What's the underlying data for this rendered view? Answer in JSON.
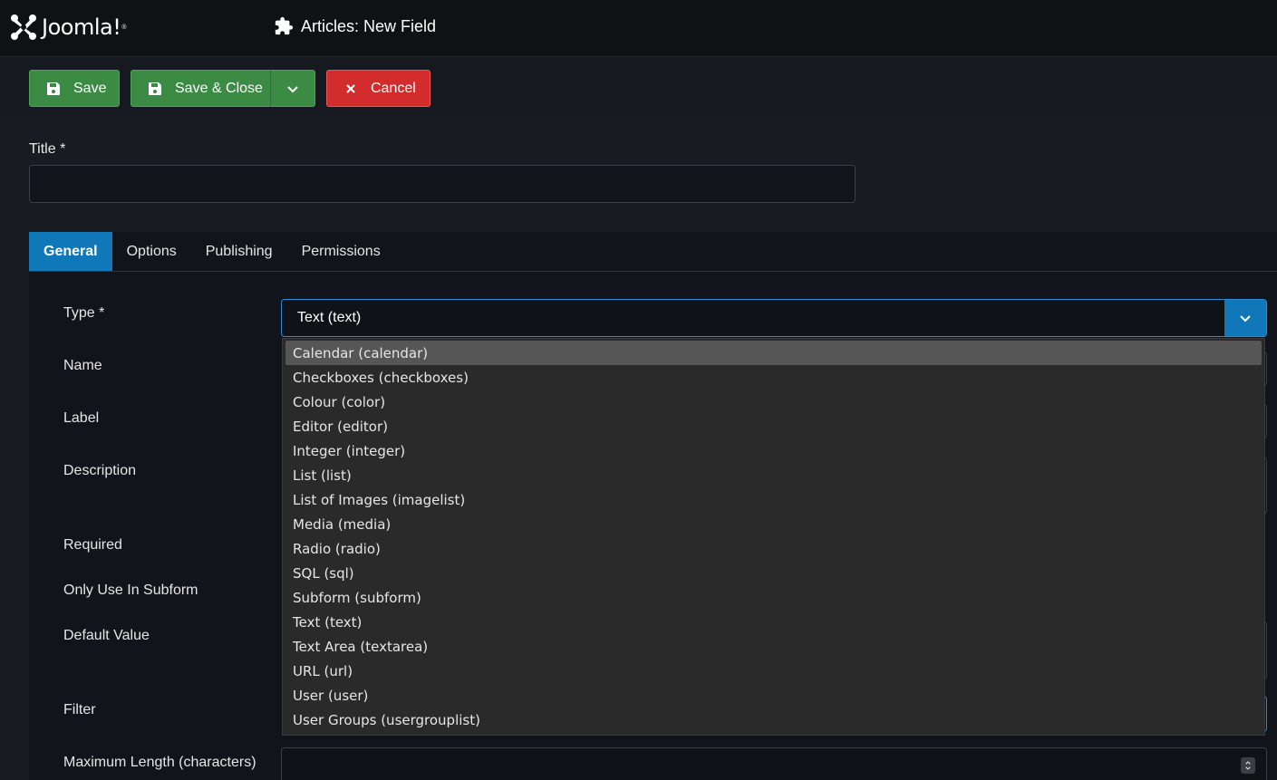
{
  "header": {
    "logo_text": "Joomla!",
    "logo_icon": "joomla-logo-icon",
    "page_title": "Articles: New Field",
    "page_icon": "puzzle-piece-icon"
  },
  "toolbar": {
    "save_label": "Save",
    "save_close_label": "Save & Close",
    "cancel_label": "Cancel",
    "save_icon": "floppy-disk-icon",
    "dropdown_icon": "chevron-down-icon",
    "cancel_icon": "close-icon"
  },
  "form": {
    "title_label": "Title *",
    "title_value": ""
  },
  "tabs": [
    {
      "label": "General",
      "active": true
    },
    {
      "label": "Options",
      "active": false
    },
    {
      "label": "Publishing",
      "active": false
    },
    {
      "label": "Permissions",
      "active": false
    }
  ],
  "general": {
    "labels": {
      "type": "Type *",
      "name": "Name",
      "label": "Label",
      "description": "Description",
      "required": "Required",
      "only_use_in_subform": "Only Use In Subform",
      "default_value": "Default Value",
      "filter": "Filter",
      "max_length": "Maximum Length (characters)"
    },
    "type_selected": "Text (text)"
  },
  "type_options": [
    "Calendar (calendar)",
    "Checkboxes (checkboxes)",
    "Colour (color)",
    "Editor (editor)",
    "Integer (integer)",
    "List (list)",
    "List of Images (imagelist)",
    "Media (media)",
    "Radio (radio)",
    "SQL (sql)",
    "Subform (subform)",
    "Text (text)",
    "Text Area (textarea)",
    "URL (url)",
    "User (user)",
    "User Groups (usergrouplist)"
  ],
  "dropdown_highlighted": "Calendar (calendar)",
  "colors": {
    "accent": "#1077b8",
    "save_green": "#3c8b45",
    "cancel_red": "#d22c2c",
    "background": "#181c22"
  }
}
